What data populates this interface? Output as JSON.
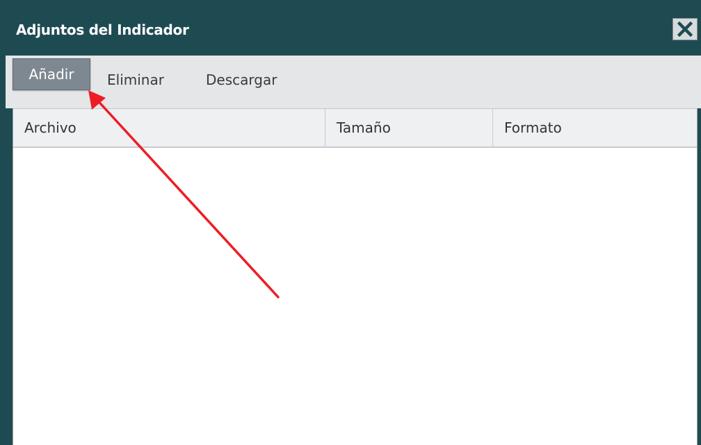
{
  "window": {
    "title": "Adjuntos del Indicador",
    "close_icon": "close-icon",
    "colors": {
      "titlebar": "#1e4b52",
      "toolbar": "#e4e6e8",
      "active_button": "#7e8890",
      "annotation_arrow": "#ee1c24"
    }
  },
  "toolbar": {
    "add_label": "Añadir",
    "delete_label": "Eliminar",
    "download_label": "Descargar"
  },
  "table": {
    "columns": [
      "Archivo",
      "Tamaño",
      "Formato"
    ],
    "rows": []
  },
  "annotation": {
    "type": "arrow",
    "points_to": "add-button"
  }
}
